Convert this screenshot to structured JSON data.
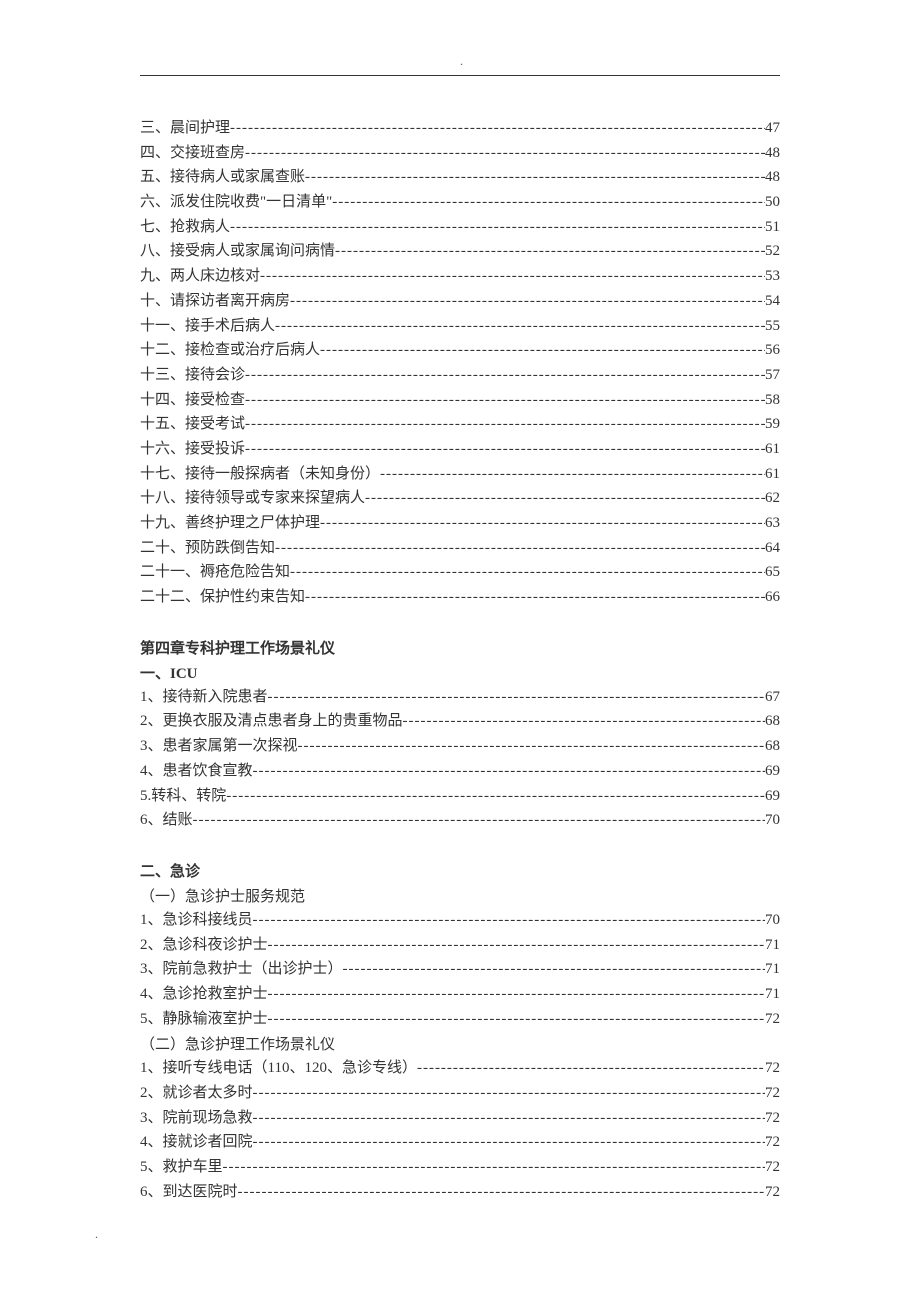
{
  "sections": [
    {
      "type": "entry",
      "label": "三、晨间护理",
      "page": "47"
    },
    {
      "type": "entry",
      "label": "四、交接班查房",
      "page": "48"
    },
    {
      "type": "entry",
      "label": "五、接待病人或家属查账",
      "page": "48"
    },
    {
      "type": "entry",
      "label": "六、派发住院收费\"一日清单\"",
      "page": "50"
    },
    {
      "type": "entry",
      "label": "七、抢救病人",
      "page": "51"
    },
    {
      "type": "entry",
      "label": "八、接受病人或家属询问病情",
      "page": "52"
    },
    {
      "type": "entry",
      "label": "九、两人床边核对",
      "page": "53"
    },
    {
      "type": "entry",
      "label": "十、请探访者离开病房",
      "page": "54"
    },
    {
      "type": "entry",
      "label": "十一、接手术后病人",
      "page": "55"
    },
    {
      "type": "entry",
      "label": "十二、接检查或治疗后病人",
      "page": "56"
    },
    {
      "type": "entry",
      "label": "十三、接待会诊",
      "page": "57"
    },
    {
      "type": "entry",
      "label": "十四、接受检查",
      "page": "58"
    },
    {
      "type": "entry",
      "label": "十五、接受考试",
      "page": "59"
    },
    {
      "type": "entry",
      "label": "十六、接受投诉",
      "page": "61"
    },
    {
      "type": "entry",
      "label": "十七、接待一般探病者（未知身份）",
      "page": "61"
    },
    {
      "type": "entry",
      "label": "十八、接待领导或专家来探望病人",
      "page": "62"
    },
    {
      "type": "entry",
      "label": "十九、善终护理之尸体护理",
      "page": "63"
    },
    {
      "type": "entry",
      "label": "二十、预防跌倒告知",
      "page": "64"
    },
    {
      "type": "entry",
      "label": "二十一、褥疮危险告知",
      "page": "65"
    },
    {
      "type": "entry",
      "label": "二十二、保护性约束告知",
      "page": "66"
    },
    {
      "type": "spacer"
    },
    {
      "type": "heading",
      "label": "第四章专科护理工作场景礼仪"
    },
    {
      "type": "heading",
      "label": "一、ICU"
    },
    {
      "type": "entry",
      "label": "1、接待新入院患者",
      "page": "67"
    },
    {
      "type": "entry",
      "label": "2、更换衣服及清点患者身上的贵重物品",
      "page": "68"
    },
    {
      "type": "entry",
      "label": "3、患者家属第一次探视",
      "page": "68"
    },
    {
      "type": "entry",
      "label": "4、患者饮食宣教",
      "page": "69"
    },
    {
      "type": "entry",
      "label": "5.转科、转院",
      "page": "69"
    },
    {
      "type": "entry",
      "label": "6、结账",
      "page": "70"
    },
    {
      "type": "spacer"
    },
    {
      "type": "heading",
      "label": "二、急诊"
    },
    {
      "type": "sub",
      "label": "（一）急诊护士服务规范"
    },
    {
      "type": "entry",
      "label": "1、急诊科接线员",
      "page": "70"
    },
    {
      "type": "entry",
      "label": "2、急诊科夜诊护士",
      "page": "71"
    },
    {
      "type": "entry",
      "label": "3、院前急救护士（出诊护士）",
      "page": "71"
    },
    {
      "type": "entry",
      "label": "4、急诊抢救室护士",
      "page": "71"
    },
    {
      "type": "entry",
      "label": "5、静脉输液室护士",
      "page": "72"
    },
    {
      "type": "sub",
      "label": "（二）急诊护理工作场景礼仪"
    },
    {
      "type": "entry",
      "label": "1、接听专线电话（110、120、急诊专线）",
      "page": "72"
    },
    {
      "type": "entry",
      "label": "2、就诊者太多时",
      "page": "72"
    },
    {
      "type": "entry",
      "label": "3、院前现场急救 ",
      "page": "72"
    },
    {
      "type": "entry",
      "label": "4、接就诊者回院",
      "page": "72"
    },
    {
      "type": "entry",
      "label": "5、救护车里",
      "page": "72"
    },
    {
      "type": "entry",
      "label": "6、到达医院时",
      "page": "72"
    }
  ]
}
